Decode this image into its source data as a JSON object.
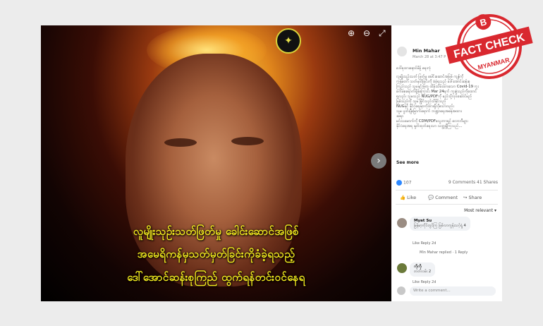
{
  "viewer": {
    "caption_lines": [
      "လူမျိုးသုဉ်းသတ်ဖြတ်မှု ခေါင်းဆောင်အဖြစ်",
      "အမေရိကန်မှသတ်မှတ်ခြင်းကိုခံခဲ့ရသည့်",
      "ဒေါ်အောင်ဆန်းစုကြည် ထွက်ရန်တင်းဝင်နေရ"
    ],
    "zoom_in_icon": "zoom-in-icon",
    "zoom_out_icon": "zoom-out-icon",
    "fullscreen_icon": "expand-icon",
    "next_icon": "chevron-right-icon"
  },
  "post": {
    "author": "Min Mahar",
    "date": "March 28 at 3:47 P",
    "text_lines": [
      "ဒေါ်စုထားနောင်မိန့် ရေးကုံ",
      "လူမျိုးသုဉ်းသတ် ဖြတ်မှု ခေါင်းဆောင်အဖြစ် ကျန်ကို",
      "ကန်တော် သတ်မှတ်ခြင်းကို ခံခဲ့ရသည် ဒေါ်အောင်ဆန်းစု",
      "ကြည်သည် သူမနှင့်အတူ ထိန်းသိမ်းထားသော Covid-19 ကူး",
      "စက်စေရောက်ရှိခဲ့ကြောင်း Mar 24ရက် ကူးနံ့သည်ကိုထောင်",
      "ရလည်း သူမသည် NUG/PDFကို မည်သို့လုပ်ဆောင်မည်",
      "ဖြစ်သည်ကို သူမ မြိုင်သည်သိနိုင်သည်",
      "NUGနှင့် နိုင်ငံရေးမှာကိုထားရှိလိုသောလည်း",
      "သူမ ပွတ်ချီမြောက်ရောက် ဘဏ္ဍာရေးအနေအထား",
      "ဆရာ",
      "မင်းသမောက်ကို CDM/PDFသွေးကာရင် လောဘီများ",
      "နိုင်ငံရေးအရ နှုတ်ထုတ်ရေးသာ သတ္တုရှိကြသည်..."
    ],
    "see_more": "See more",
    "reactions": "107",
    "comments_count": "9 Comments",
    "shares_count": "41 Shares",
    "actions": [
      "Like",
      "Comment",
      "Share"
    ],
    "sort": "Most relevant"
  },
  "comments": [
    {
      "author": "Myat Su",
      "text": "မြန်မာ့ကိုင်တွင်ကြ ဖြစ်လာကွန်းသင့်ရှုံ",
      "reacts": "4",
      "like": "Like",
      "reply": "Reply",
      "time": "2d",
      "replied_by": "Min Mahar replied",
      "reply_count": "1 Reply"
    },
    {
      "author": "ကိုကို",
      "text": "တတ်လမ်း",
      "reacts": "2",
      "like": "Like",
      "reply": "Reply",
      "time": "2d"
    }
  ],
  "comment_input": {
    "placeholder": "Write a comment..."
  },
  "badge": {
    "letter": "B",
    "title": "FACT CHECK",
    "sub": "MYANMAR",
    "colors": {
      "red": "#d9282f",
      "white": "#ffffff"
    }
  }
}
